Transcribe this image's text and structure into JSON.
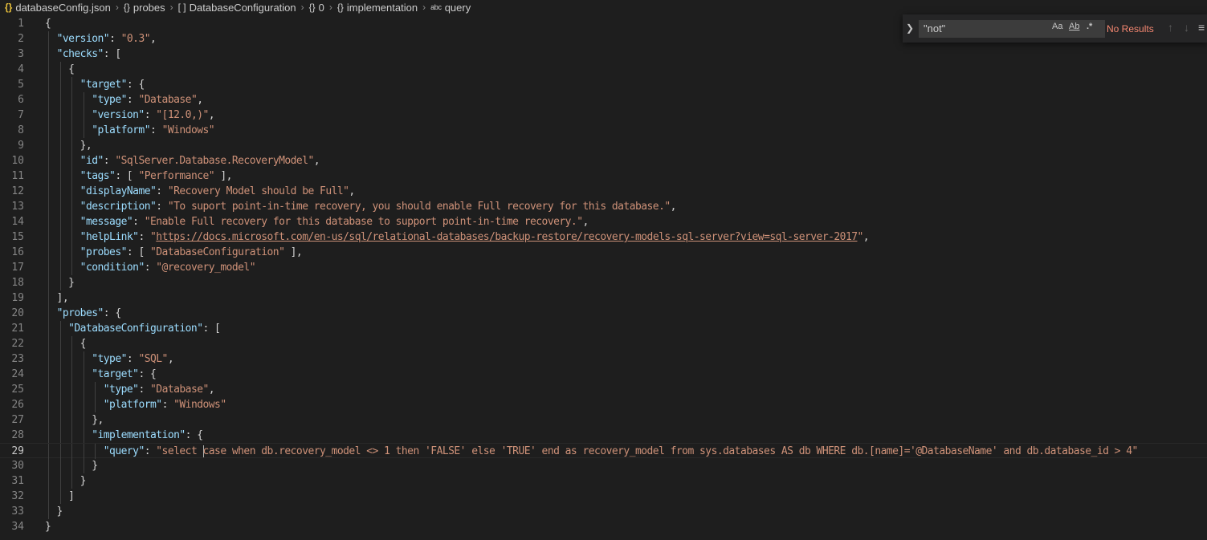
{
  "breadcrumb": [
    {
      "icon": "json-file-icon",
      "glyph": "{}",
      "label": "databaseConfig.json"
    },
    {
      "icon": "object-icon",
      "glyph": "{}",
      "label": "probes"
    },
    {
      "icon": "array-icon",
      "glyph": "[ ]",
      "label": "DatabaseConfiguration"
    },
    {
      "icon": "object-icon",
      "glyph": "{}",
      "label": "0"
    },
    {
      "icon": "object-icon",
      "glyph": "{}",
      "label": "implementation"
    },
    {
      "icon": "string-icon",
      "glyph": "abc",
      "label": "query"
    }
  ],
  "find": {
    "value": "\"not\"",
    "match_case": "Aa",
    "whole_word": "Ab",
    "regex": ".*",
    "status": "No Results"
  },
  "editor": {
    "active_line": 29,
    "lines": [
      [
        [
          "p",
          "{"
        ]
      ],
      [
        [
          "p",
          "  "
        ],
        [
          "k",
          "\"version\""
        ],
        [
          "p",
          ": "
        ],
        [
          "s",
          "\"0.3\""
        ],
        [
          "p",
          ","
        ]
      ],
      [
        [
          "p",
          "  "
        ],
        [
          "k",
          "\"checks\""
        ],
        [
          "p",
          ": ["
        ]
      ],
      [
        [
          "p",
          "    {"
        ]
      ],
      [
        [
          "p",
          "      "
        ],
        [
          "k",
          "\"target\""
        ],
        [
          "p",
          ": {"
        ]
      ],
      [
        [
          "p",
          "        "
        ],
        [
          "k",
          "\"type\""
        ],
        [
          "p",
          ": "
        ],
        [
          "s",
          "\"Database\""
        ],
        [
          "p",
          ","
        ]
      ],
      [
        [
          "p",
          "        "
        ],
        [
          "k",
          "\"version\""
        ],
        [
          "p",
          ": "
        ],
        [
          "s",
          "\"[12.0,)\""
        ],
        [
          "p",
          ","
        ]
      ],
      [
        [
          "p",
          "        "
        ],
        [
          "k",
          "\"platform\""
        ],
        [
          "p",
          ": "
        ],
        [
          "s",
          "\"Windows\""
        ]
      ],
      [
        [
          "p",
          "      },"
        ]
      ],
      [
        [
          "p",
          "      "
        ],
        [
          "k",
          "\"id\""
        ],
        [
          "p",
          ": "
        ],
        [
          "s",
          "\"SqlServer.Database.RecoveryModel\""
        ],
        [
          "p",
          ","
        ]
      ],
      [
        [
          "p",
          "      "
        ],
        [
          "k",
          "\"tags\""
        ],
        [
          "p",
          ": [ "
        ],
        [
          "s",
          "\"Performance\""
        ],
        [
          "p",
          " ],"
        ]
      ],
      [
        [
          "p",
          "      "
        ],
        [
          "k",
          "\"displayName\""
        ],
        [
          "p",
          ": "
        ],
        [
          "s",
          "\"Recovery Model should be Full\""
        ],
        [
          "p",
          ","
        ]
      ],
      [
        [
          "p",
          "      "
        ],
        [
          "k",
          "\"description\""
        ],
        [
          "p",
          ": "
        ],
        [
          "s",
          "\"To suport point-in-time recovery, you should enable Full recovery for this database.\""
        ],
        [
          "p",
          ","
        ]
      ],
      [
        [
          "p",
          "      "
        ],
        [
          "k",
          "\"message\""
        ],
        [
          "p",
          ": "
        ],
        [
          "s",
          "\"Enable Full recovery for this database to support point-in-time recovery.\""
        ],
        [
          "p",
          ","
        ]
      ],
      [
        [
          "p",
          "      "
        ],
        [
          "k",
          "\"helpLink\""
        ],
        [
          "p",
          ": "
        ],
        [
          "s",
          "\""
        ],
        [
          "su",
          "https://docs.microsoft.com/en-us/sql/relational-databases/backup-restore/recovery-models-sql-server?view=sql-server-2017"
        ],
        [
          "s",
          "\""
        ],
        [
          "p",
          ","
        ]
      ],
      [
        [
          "p",
          "      "
        ],
        [
          "k",
          "\"probes\""
        ],
        [
          "p",
          ": [ "
        ],
        [
          "s",
          "\"DatabaseConfiguration\""
        ],
        [
          "p",
          " ],"
        ]
      ],
      [
        [
          "p",
          "      "
        ],
        [
          "k",
          "\"condition\""
        ],
        [
          "p",
          ": "
        ],
        [
          "s",
          "\"@recovery_model\""
        ]
      ],
      [
        [
          "p",
          "    }"
        ]
      ],
      [
        [
          "p",
          "  ],"
        ]
      ],
      [
        [
          "p",
          "  "
        ],
        [
          "k",
          "\"probes\""
        ],
        [
          "p",
          ": {"
        ]
      ],
      [
        [
          "p",
          "    "
        ],
        [
          "k",
          "\"DatabaseConfiguration\""
        ],
        [
          "p",
          ": ["
        ]
      ],
      [
        [
          "p",
          "      {"
        ]
      ],
      [
        [
          "p",
          "        "
        ],
        [
          "k",
          "\"type\""
        ],
        [
          "p",
          ": "
        ],
        [
          "s",
          "\"SQL\""
        ],
        [
          "p",
          ","
        ]
      ],
      [
        [
          "p",
          "        "
        ],
        [
          "k",
          "\"target\""
        ],
        [
          "p",
          ": {"
        ]
      ],
      [
        [
          "p",
          "          "
        ],
        [
          "k",
          "\"type\""
        ],
        [
          "p",
          ": "
        ],
        [
          "s",
          "\"Database\""
        ],
        [
          "p",
          ","
        ]
      ],
      [
        [
          "p",
          "          "
        ],
        [
          "k",
          "\"platform\""
        ],
        [
          "p",
          ": "
        ],
        [
          "s",
          "\"Windows\""
        ]
      ],
      [
        [
          "p",
          "        },"
        ]
      ],
      [
        [
          "p",
          "        "
        ],
        [
          "k",
          "\"implementation\""
        ],
        [
          "p",
          ": {"
        ]
      ],
      [
        [
          "p",
          "          "
        ],
        [
          "k",
          "\"query\""
        ],
        [
          "p",
          ": "
        ],
        [
          "s",
          "\"select "
        ],
        [
          "cursor",
          ""
        ],
        [
          "s",
          "case when db.recovery_model <> 1 then 'FALSE' else 'TRUE' end as recovery_model from sys.databases AS db WHERE db.[name]='@DatabaseName' and db.database_id > 4\""
        ]
      ],
      [
        [
          "p",
          "        }"
        ]
      ],
      [
        [
          "p",
          "      }"
        ]
      ],
      [
        [
          "p",
          "    ]"
        ]
      ],
      [
        [
          "p",
          "  }"
        ]
      ],
      [
        [
          "p",
          "}"
        ]
      ]
    ]
  }
}
